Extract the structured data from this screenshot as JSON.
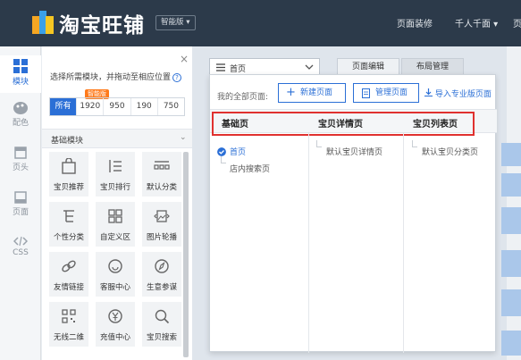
{
  "header": {
    "brand": "淘宝旺铺",
    "edition": "智能版",
    "edition_arrow": "▾",
    "nav": [
      "页面装修",
      "千人千面 ▾",
      "页"
    ]
  },
  "left_nav": [
    {
      "label": "模块",
      "icon": "grid-icon",
      "active": true
    },
    {
      "label": "配色",
      "icon": "palette-icon"
    },
    {
      "label": "页头",
      "icon": "header-icon"
    },
    {
      "label": "页面",
      "icon": "page-icon"
    },
    {
      "label": "CSS",
      "icon": "code-icon"
    }
  ],
  "module_panel": {
    "hint": "选择所需模块，并拖动至相应位置",
    "close": "×",
    "help": "?",
    "filters": [
      "所有",
      "1920",
      "950",
      "190",
      "750"
    ],
    "smart_badge": "智能版",
    "section": "基础模块",
    "section_chevron": "⌄",
    "tiles": [
      {
        "label": "宝贝推荐",
        "icon": "bag-icon"
      },
      {
        "label": "宝贝排行",
        "icon": "ranking-icon"
      },
      {
        "label": "默认分类",
        "icon": "category-icon"
      },
      {
        "label": "个性分类",
        "icon": "tree-icon"
      },
      {
        "label": "自定义区",
        "icon": "custom-grid-icon"
      },
      {
        "label": "图片轮播",
        "icon": "image-carousel-icon"
      },
      {
        "label": "友情链接",
        "icon": "link-icon"
      },
      {
        "label": "客服中心",
        "icon": "service-icon"
      },
      {
        "label": "生意参谋",
        "icon": "compass-icon"
      },
      {
        "label": "无线二维",
        "icon": "qrcode-icon"
      },
      {
        "label": "充值中心",
        "icon": "yuan-icon"
      },
      {
        "label": "宝贝搜索",
        "icon": "search-icon"
      }
    ]
  },
  "toolbar": {
    "page_select": "首页",
    "tab_edit": "页面编辑",
    "tab_layout": "布局管理"
  },
  "dropdown": {
    "label": "我的全部页面:",
    "new_btn": "新建页面",
    "new_icon": "+",
    "manage_btn": "管理页面",
    "import_link": "导入专业版页面",
    "columns": [
      "基础页",
      "宝贝详情页",
      "宝贝列表页"
    ],
    "basic_pages": [
      "首页",
      "店内搜索页"
    ],
    "detail_pages": [
      "默认宝贝详情页"
    ],
    "list_pages": [
      "默认宝贝分类页"
    ]
  },
  "colors": {
    "accent": "#2b6fd6",
    "topbar": "#2c3a4a",
    "highlight": "#e0312f",
    "badge": "#ff7a1a"
  }
}
